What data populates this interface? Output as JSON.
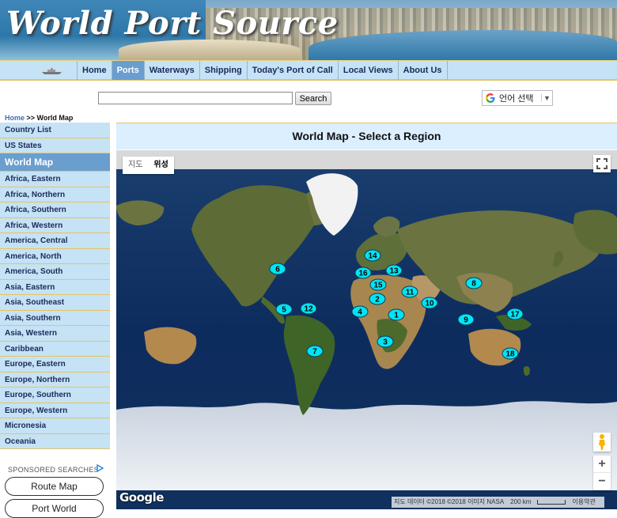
{
  "site": {
    "title": "World Port Source"
  },
  "nav": {
    "items": [
      {
        "label": "Home",
        "active": false
      },
      {
        "label": "Ports",
        "active": true
      },
      {
        "label": "Waterways",
        "active": false
      },
      {
        "label": "Shipping",
        "active": false
      },
      {
        "label": "Today's Port of Call",
        "active": false
      },
      {
        "label": "Local Views",
        "active": false
      },
      {
        "label": "About Us",
        "active": false
      }
    ]
  },
  "search": {
    "value": "",
    "button_label": "Search"
  },
  "translate": {
    "label": "언어 선택",
    "arrow": "▼"
  },
  "breadcrumb": {
    "home": "Home",
    "separator": " >> ",
    "current": "World Map"
  },
  "sidebar": {
    "items": [
      {
        "label": "Country List",
        "active": false
      },
      {
        "label": "US States",
        "active": false
      },
      {
        "label": "World Map",
        "active": true
      },
      {
        "label": "Africa, Eastern",
        "active": false
      },
      {
        "label": "Africa, Northern",
        "active": false
      },
      {
        "label": "Africa, Southern",
        "active": false
      },
      {
        "label": "Africa, Western",
        "active": false
      },
      {
        "label": "America, Central",
        "active": false
      },
      {
        "label": "America, North",
        "active": false
      },
      {
        "label": "America, South",
        "active": false
      },
      {
        "label": "Asia, Eastern",
        "active": false
      },
      {
        "label": "Asia, Southeast",
        "active": false
      },
      {
        "label": "Asia, Southern",
        "active": false
      },
      {
        "label": "Asia, Western",
        "active": false
      },
      {
        "label": "Caribbean",
        "active": false
      },
      {
        "label": "Europe, Eastern",
        "active": false
      },
      {
        "label": "Europe, Northern",
        "active": false
      },
      {
        "label": "Europe, Southern",
        "active": false
      },
      {
        "label": "Europe, Western",
        "active": false
      },
      {
        "label": "Micronesia",
        "active": false
      },
      {
        "label": "Oceania",
        "active": false
      }
    ]
  },
  "sponsored": {
    "label": "SPONSORED SEARCHES",
    "buttons": [
      "Route Map",
      "Port World"
    ]
  },
  "map": {
    "header": "World Map - Select a Region",
    "type_buttons": [
      {
        "label": "지도",
        "active": false
      },
      {
        "label": "위성",
        "active": true
      }
    ],
    "markers": [
      "1",
      "2",
      "3",
      "4",
      "5",
      "6",
      "7",
      "8",
      "9",
      "10",
      "11",
      "12",
      "13",
      "14",
      "15",
      "16",
      "17",
      "18"
    ],
    "marker_color": "#00e5f5",
    "zoom_in": "+",
    "zoom_out": "−",
    "logo": "Google",
    "attribution": {
      "data": "지도 데이터 ©2018 ©2018 이미지 NASA",
      "scale": "200 km",
      "terms": "이용약관"
    }
  },
  "colors": {
    "nav_bg": "#c6e2f5",
    "nav_active": "#6a9ecf",
    "border_gold": "#e4c463",
    "ocean": "#0e2a5c",
    "land": "#5a6b33"
  }
}
